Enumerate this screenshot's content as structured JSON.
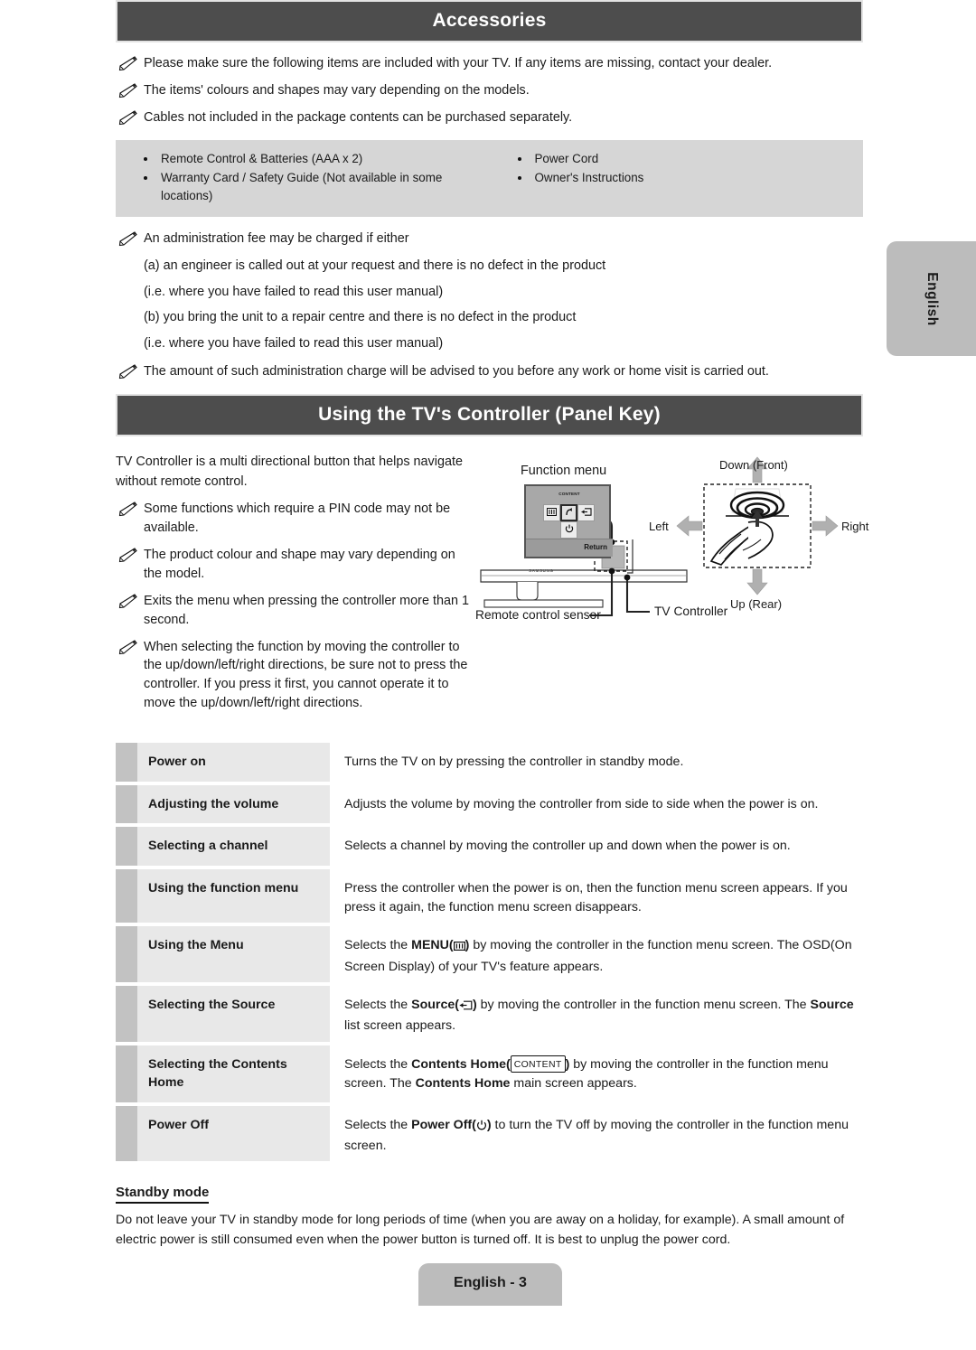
{
  "sections": {
    "accessories": {
      "title": "Accessories",
      "notes": [
        "Please make sure the following items are included with your TV. If any items are missing, contact your dealer.",
        "The items' colours and shapes may vary depending on the models.",
        "Cables not included in the package contents can be purchased separately."
      ],
      "items_left": [
        "Remote Control & Batteries (AAA x 2)",
        "Warranty Card / Safety Guide (Not available in some locations)"
      ],
      "items_right": [
        "Power Cord",
        "Owner's Instructions"
      ],
      "fee_note": "An administration fee may be charged if either",
      "fee_lines": [
        "(a) an engineer is called out at your request and there is no defect in the product",
        "(i.e. where you have failed to read this user manual)",
        "(b) you bring the unit to a repair centre and there is no defect in the product",
        "(i.e. where you have failed to read this user manual)"
      ],
      "charge_note": "The amount of such administration charge will be advised to you before any work or home visit is carried out."
    },
    "controller": {
      "title": "Using the TV's Controller (Panel Key)",
      "intro": "TV Controller is a multi directional button that helps navigate without remote control.",
      "notes": [
        "Some functions which require a PIN code may not be available.",
        "The product colour and shape may vary depending on the model.",
        "Exits the menu when pressing the controller more than 1 second.",
        "When selecting the function by moving the controller to the up/down/left/right directions, be sure not to press the controller. If you press it first, you cannot operate it to move the up/down/left/right directions."
      ],
      "diagram": {
        "function_menu_caption": "Function menu",
        "content_key_label": "CONTENT",
        "return_label": "Return",
        "brand": "SAMSUNG",
        "remote_sensor_label": "Remote control sensor",
        "tv_controller_label": "TV Controller",
        "dir_down": "Down (Front)",
        "dir_up": "Up (Rear)",
        "dir_left": "Left",
        "dir_right": "Right"
      },
      "table": [
        {
          "label": "Power on",
          "desc_parts": [
            {
              "text": "Turns the TV on by pressing the controller in standby mode."
            }
          ]
        },
        {
          "label": "Adjusting the volume",
          "desc_parts": [
            {
              "text": "Adjusts the volume by moving the controller from side to side when the power is on."
            }
          ]
        },
        {
          "label": "Selecting a channel",
          "desc_parts": [
            {
              "text": "Selects a channel by moving the controller up and down when the power is on."
            }
          ]
        },
        {
          "label": "Using the function menu",
          "desc_parts": [
            {
              "text": "Press the controller when the power is on, then the function menu screen appears. If you press it again, the function menu screen disappears."
            }
          ]
        },
        {
          "label": "Using the Menu",
          "desc_parts": [
            {
              "text": "Selects the "
            },
            {
              "text": "MENU(",
              "bold": true
            },
            {
              "icon": "menu-icon"
            },
            {
              "text": ")",
              "bold": true
            },
            {
              "text": " by moving the controller in the function menu screen. The OSD(On Screen Display) of your TV's feature appears."
            }
          ]
        },
        {
          "label": "Selecting the Source",
          "desc_parts": [
            {
              "text": "Selects the "
            },
            {
              "text": "Source(",
              "bold": true
            },
            {
              "icon": "source-icon"
            },
            {
              "text": ")",
              "bold": true
            },
            {
              "text": " by moving the controller in the function menu screen. The "
            },
            {
              "text": "Source",
              "bold": true
            },
            {
              "text": " list screen appears."
            }
          ]
        },
        {
          "label": "Selecting the Contents Home",
          "desc_parts": [
            {
              "text": "Selects the "
            },
            {
              "text": "Contents Home(",
              "bold": true
            },
            {
              "icon": "content-badge",
              "label": "CONTENT"
            },
            {
              "text": ")",
              "bold": true
            },
            {
              "text": " by moving the controller in the function menu screen. The "
            },
            {
              "text": "Contents Home",
              "bold": true
            },
            {
              "text": " main screen appears."
            }
          ]
        },
        {
          "label": "Power Off",
          "desc_parts": [
            {
              "text": "Selects the "
            },
            {
              "text": "Power Off(",
              "bold": true
            },
            {
              "icon": "power-icon"
            },
            {
              "text": ")",
              "bold": true
            },
            {
              "text": " to turn the TV off by moving the controller in the function menu screen."
            }
          ]
        }
      ]
    },
    "standby": {
      "title": "Standby mode",
      "body": "Do not leave your TV in standby mode for long periods of time (when you are away on a holiday, for example). A small amount of electric power is still consumed even when the power button is turned off. It is best to unplug the power cord."
    }
  },
  "side_tab": {
    "label": "English"
  },
  "footer": {
    "label": "English - 3"
  },
  "colors": {
    "header_bar": "#4d4d4d",
    "accessory_box": "#d6d6d6",
    "table_label_bg": "#e8e8e8",
    "table_accent": "#c2c2c2",
    "tab_bg": "#bcbcbc"
  }
}
